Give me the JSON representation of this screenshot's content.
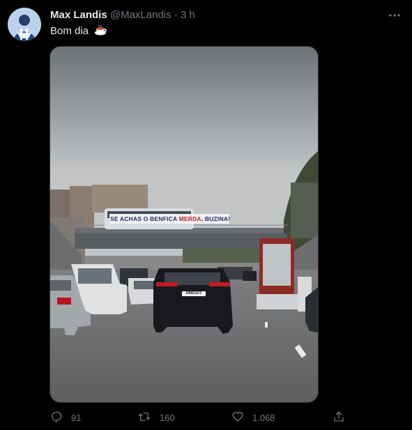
{
  "tweet": {
    "author_name": "Max Landis",
    "handle": "@MaxLandis",
    "separator": "·",
    "time": "3 h",
    "text": "Bom dia",
    "text_emoji": "coffee-icon"
  },
  "media": {
    "banner_text_1": "SE ACHAS O BENFICA ",
    "banner_text_2": "MERDA",
    "banner_text_3": ", BUZINA!",
    "plate_text": "AN51UT"
  },
  "actions": {
    "reply_count": "91",
    "retweet_count": "160",
    "like_count": "1.068"
  },
  "colors": {
    "background": "#000000",
    "text": "#e7e9ea",
    "muted": "#71767b",
    "border": "#2f3336"
  }
}
